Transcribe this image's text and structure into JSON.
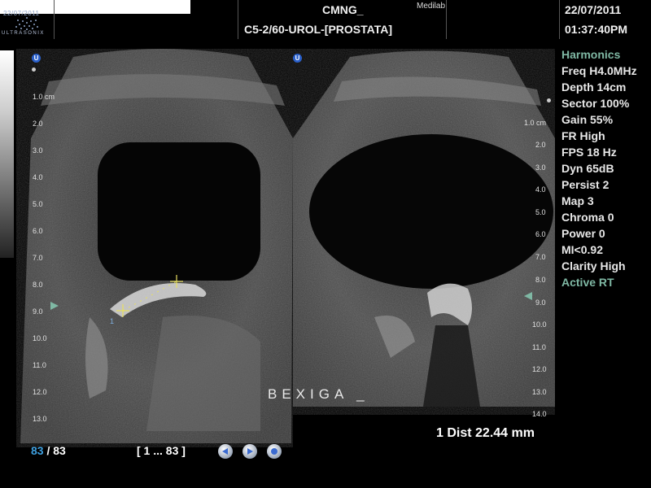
{
  "header": {
    "logo_date": "22/07/2011",
    "logo_word": "ULTRASONIX",
    "patient": "CMNG_",
    "site": "Medilab",
    "preset": "C5-2/60-UROL-[PROSTATA]",
    "date": "22/07/2011",
    "time": "01:37:40PM"
  },
  "left_pane": {
    "depth_labels": [
      "1.0 cm",
      "2.0",
      "3.0",
      "4.0",
      "5.0",
      "6.0",
      "7.0",
      "8.0",
      "9.0",
      "10.0",
      "11.0",
      "12.0",
      "13.0"
    ],
    "caliper_label": "1"
  },
  "right_pane": {
    "depth_labels": [
      "1.0 cm",
      "2.0",
      "3.0",
      "4.0",
      "5.0",
      "6.0",
      "7.0",
      "8.0",
      "9.0",
      "10.0",
      "11.0",
      "12.0",
      "13.0",
      "14.0"
    ]
  },
  "params": {
    "harmonics": "Harmonics",
    "freq": "Freq H4.0MHz",
    "depth": "Depth 14cm",
    "sector": "Sector 100%",
    "gain": "Gain 55%",
    "fr": "FR High",
    "fps": "FPS 18 Hz",
    "dyn": "Dyn 65dB",
    "persist": "Persist 2",
    "map": "Map 3",
    "chroma": "Chroma 0",
    "power": "Power 0",
    "mi": "MI<0.92",
    "clarity": "Clarity High",
    "active": "Active RT"
  },
  "caption": "BEXIGA _",
  "measurement": "1  Dist 22.44 mm",
  "cine": {
    "current": "83",
    "separator": " / ",
    "total": "83",
    "range": "[ 1 ... 83 ]"
  },
  "colors": {
    "accent": "#7fb8a4",
    "frame_current": "#3ea0e0",
    "caliper": "#e8e060",
    "icon_blue": "#2a5fc8"
  }
}
